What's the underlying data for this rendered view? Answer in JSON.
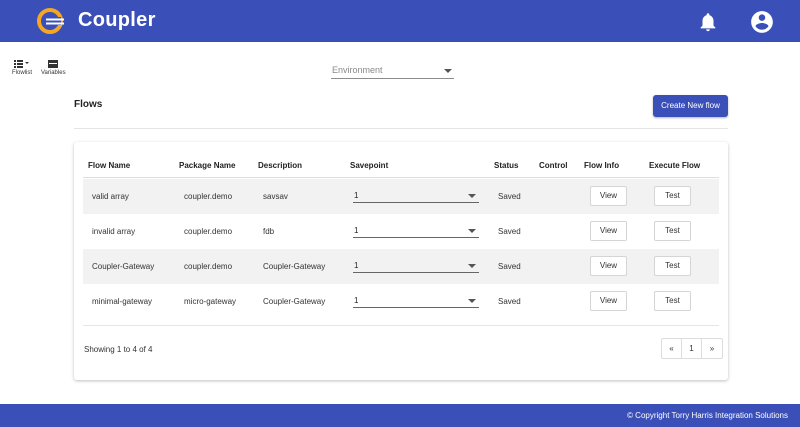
{
  "header": {
    "brand": "Coupler",
    "colors": {
      "primary": "#3b4fb8",
      "logo_accent": "#f5a623"
    },
    "icons": [
      "bell-icon",
      "account-circle-icon"
    ]
  },
  "toolbar": {
    "flowlist_label": "Flowlist",
    "variables_label": "Variables"
  },
  "environment": {
    "placeholder": "Environment"
  },
  "flows": {
    "title": "Flows",
    "create_button": "Create New flow"
  },
  "table": {
    "columns": [
      "Flow Name",
      "Package Name",
      "Description",
      "Savepoint",
      "Status",
      "Control",
      "Flow Info",
      "Execute Flow"
    ],
    "rows": [
      {
        "name": "valid array",
        "package": "coupler.demo",
        "description": "savsav",
        "savepoint": "1",
        "status": "Saved",
        "view": "View",
        "test": "Test"
      },
      {
        "name": "invalid array",
        "package": "coupler.demo",
        "description": "fdb",
        "savepoint": "1",
        "status": "Saved",
        "view": "View",
        "test": "Test"
      },
      {
        "name": "Coupler-Gateway",
        "package": "coupler.demo",
        "description": "Coupler-Gateway",
        "savepoint": "1",
        "status": "Saved",
        "view": "View",
        "test": "Test"
      },
      {
        "name": "minimal-gateway",
        "package": "micro-gateway",
        "description": "Coupler-Gateway",
        "savepoint": "1",
        "status": "Saved",
        "view": "View",
        "test": "Test"
      }
    ]
  },
  "pagination": {
    "showing": "Showing 1 to 4 of 4",
    "prev": "«",
    "page": "1",
    "next": "»"
  },
  "footer": {
    "copyright": "© Copyright Torry Harris Integration Solutions"
  }
}
